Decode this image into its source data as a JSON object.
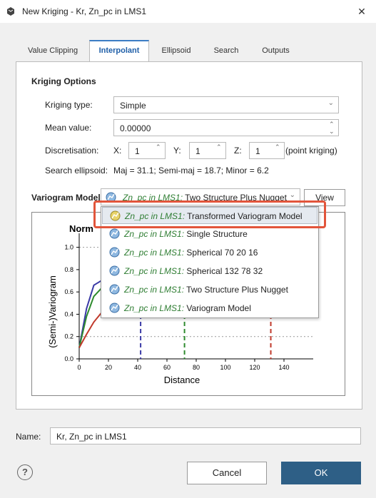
{
  "window": {
    "title": "New Kriging - Kr, Zn_pc in LMS1",
    "close_glyph": "✕"
  },
  "tabs": [
    {
      "label": "Value Clipping",
      "active": false
    },
    {
      "label": "Interpolant",
      "active": true
    },
    {
      "label": "Ellipsoid",
      "active": false
    },
    {
      "label": "Search",
      "active": false
    },
    {
      "label": "Outputs",
      "active": false
    }
  ],
  "kriging_options": {
    "heading": "Kriging Options",
    "type_label": "Kriging type:",
    "type_value": "Simple",
    "mean_label": "Mean value:",
    "mean_value": "0.00000",
    "disc_label": "Discretisation:",
    "x_label": "X:",
    "x_value": "1",
    "y_label": "Y:",
    "y_value": "1",
    "z_label": "Z:",
    "z_value": "1",
    "disc_note": "(point kriging)",
    "search_label": "Search ellipsoid:",
    "search_value": "Maj = 31.1; Semi-maj = 18.7; Minor = 6.2"
  },
  "variogram": {
    "label": "Variogram Model",
    "selected_prefix": "Zn_pc in LMS1:",
    "selected_name": "Two Structure Plus Nugget",
    "view_button": "View",
    "options": [
      {
        "prefix": "Zn_pc in LMS1:",
        "name": "Transformed Variogram Model",
        "icon": "transformed-variogram-icon",
        "selected": true
      },
      {
        "prefix": "Zn_pc in LMS1:",
        "name": "Single Structure",
        "icon": "variogram-icon"
      },
      {
        "prefix": "Zn_pc in LMS1:",
        "name": "Spherical 70 20 16",
        "icon": "variogram-icon"
      },
      {
        "prefix": "Zn_pc in LMS1:",
        "name": "Spherical 132 78 32",
        "icon": "variogram-icon"
      },
      {
        "prefix": "Zn_pc in LMS1:",
        "name": "Two Structure Plus Nugget",
        "icon": "variogram-icon"
      },
      {
        "prefix": "Zn_pc in LMS1:",
        "name": "Variogram Model",
        "icon": "variogram-icon"
      }
    ]
  },
  "chart_data": {
    "type": "line",
    "title": "Norm",
    "xlabel": "Distance",
    "ylabel": "(Semi-)Variogram",
    "xlim": [
      0,
      160
    ],
    "ylim": [
      0,
      1.1
    ],
    "x_ticks": [
      "0",
      "20",
      "40",
      "60",
      "80",
      "100",
      "120",
      "140"
    ],
    "y_ticks": [
      "0.0",
      "0.2",
      "0.4",
      "0.6",
      "0.8",
      "1.0"
    ],
    "series": [
      {
        "color": "#3a3aa6",
        "x": [
          0,
          5,
          10,
          15,
          20,
          30
        ],
        "y": [
          0.1,
          0.45,
          0.66,
          0.7,
          0.71,
          0.71
        ]
      },
      {
        "color": "#2e8b2e",
        "x": [
          0,
          5,
          10,
          15,
          20,
          30
        ],
        "y": [
          0.1,
          0.38,
          0.56,
          0.63,
          0.66,
          0.67
        ]
      },
      {
        "color": "#c0392b",
        "x": [
          0,
          5,
          10,
          15,
          20,
          30
        ],
        "y": [
          0.1,
          0.22,
          0.33,
          0.41,
          0.46,
          0.5
        ]
      }
    ],
    "vlines": [
      {
        "x": 42,
        "color": "#3a3aa6"
      },
      {
        "x": 72,
        "color": "#2e8b2e"
      },
      {
        "x": 131,
        "color": "#c0392b"
      }
    ],
    "hlines": [
      {
        "y": 1.0,
        "color": "#999999"
      },
      {
        "y": 0.2,
        "color": "#999999"
      }
    ]
  },
  "footer": {
    "name_label": "Name:",
    "name_value": "Kr, Zn_pc in LMS1",
    "help_glyph": "?",
    "cancel_label": "Cancel",
    "ok_label": "OK"
  }
}
